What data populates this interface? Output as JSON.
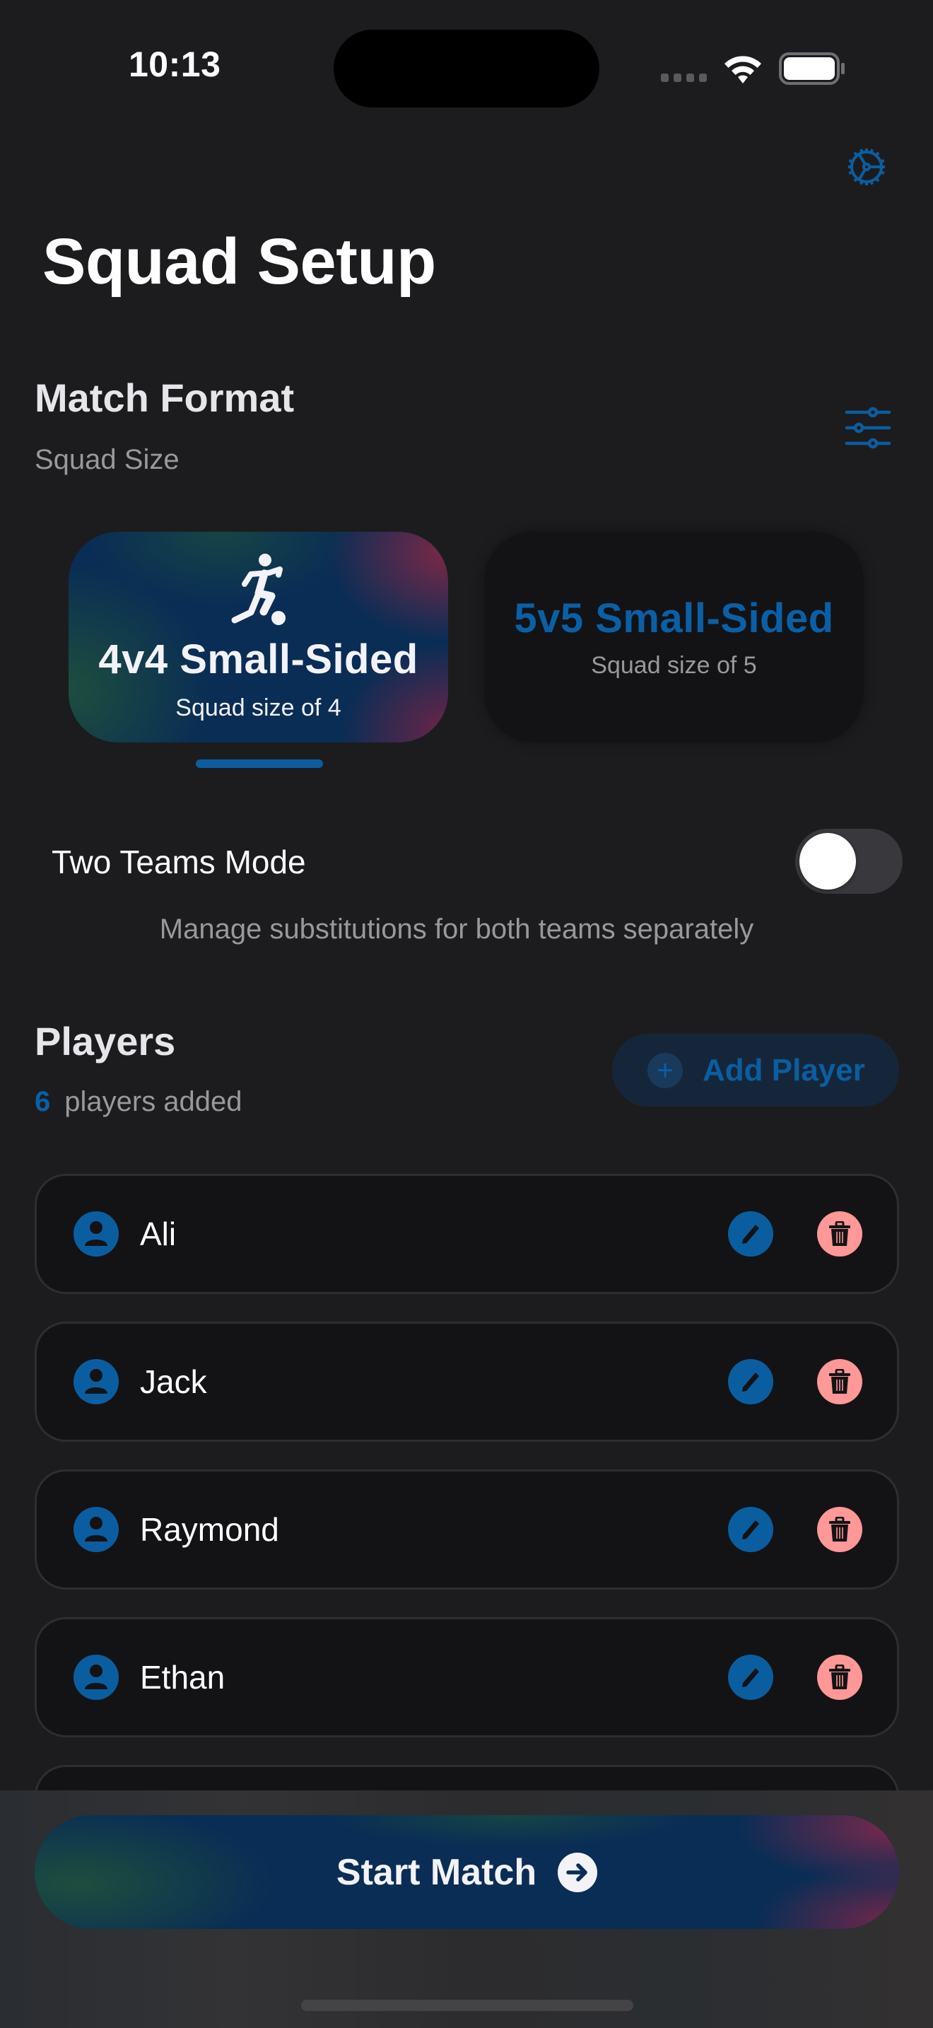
{
  "status_bar": {
    "time": "10:13"
  },
  "header": {
    "title": "Squad Setup",
    "settings_icon": "gear-icon"
  },
  "match_format": {
    "title": "Match Format",
    "subtitle": "Squad Size",
    "filter_icon": "sliders-icon",
    "options": [
      {
        "title": "4v4 Small-Sided",
        "subtitle": "Squad size of 4",
        "icon": "soccer-player-icon",
        "selected": true
      },
      {
        "title": "5v5 Small-Sided",
        "subtitle": "Squad size of 5",
        "selected": false
      }
    ],
    "page_index": 1,
    "page_count": 2
  },
  "two_teams": {
    "label": "Two Teams Mode",
    "enabled": false,
    "description": "Manage substitutions for both teams separately"
  },
  "players": {
    "title": "Players",
    "count": "6",
    "count_suffix": "players added",
    "add_button": {
      "label": "Add Player",
      "icon": "plus-circle-icon"
    },
    "list": [
      {
        "name": "Ali"
      },
      {
        "name": "Jack"
      },
      {
        "name": "Raymond"
      },
      {
        "name": "Ethan"
      },
      {
        "name": ""
      }
    ]
  },
  "footer": {
    "start_button": {
      "label": "Start Match",
      "icon": "arrow-right-circle-icon"
    }
  },
  "colors": {
    "background": "#1c1c1e",
    "accent": "#0a5ea0",
    "delete": "#ff9896",
    "card": "#131316",
    "secondary_text": "#98989d"
  }
}
